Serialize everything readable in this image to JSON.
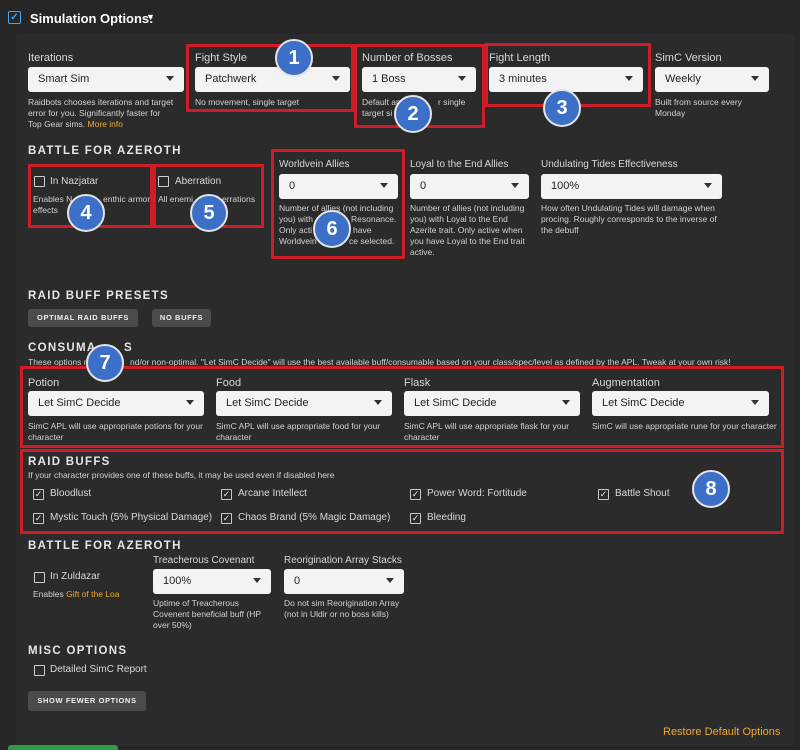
{
  "header": {
    "title": "Simulation Options:"
  },
  "iterations": {
    "label": "Iterations",
    "value": "Smart Sim",
    "help": "Raidbots chooses iterations and target error for you. Significantly faster for Top Gear sims.",
    "help_link": "More info"
  },
  "fight_style": {
    "label": "Fight Style",
    "value": "Patchwerk",
    "help": "No movement, single target"
  },
  "num_bosses": {
    "label": "Number of Bosses",
    "value": "1 Boss",
    "help_line1": "Default and",
    "help_line1b": "r single",
    "help_line2": "target si"
  },
  "fight_length": {
    "label": "Fight Length",
    "value": "3 minutes"
  },
  "simc_version": {
    "label": "SimC Version",
    "value": "Weekly",
    "help": "Built from source every Monday"
  },
  "bfa1": {
    "title": "BATTLE FOR AZEROTH",
    "nazjatar": {
      "label": "In Nazjatar",
      "help_a": "Enables N",
      "help_b": "enthic armor",
      "help_c": "effects"
    },
    "aberration": {
      "label": "Aberration",
      "help_a": "All enemi",
      "help_b": "errations"
    },
    "worldvein": {
      "label": "Worldvein Allies",
      "value": "0",
      "h1": "Number of allies (not including",
      "h2a": "you) with",
      "h2b": "Resonance.",
      "h3a": "Only acti",
      "h3b": "have",
      "h4a": "Worldvein",
      "h4b": "ce selected."
    },
    "loyal": {
      "label": "Loyal to the End Allies",
      "value": "0",
      "help": "Number of allies (not including you) with Loyal to the End Azerite trait. Only active when you have Loyal to the End trait active."
    },
    "tides": {
      "label": "Undulating Tides Effectiveness",
      "value": "100%",
      "help": "How often Undulating Tides will damage when procing. Roughly corresponds to the inverse of the debuff"
    }
  },
  "raid_presets": {
    "title": "RAID BUFF PRESETS",
    "optimal": "OPTIMAL RAID BUFFS",
    "none": "NO BUFFS"
  },
  "consumables": {
    "title_a": "CONSUMA",
    "title_b": "S",
    "note_a": "These options m",
    "note_b": "nd/or non-optimal. \"Let SimC Decide\" will use the best available buff/consumable based on your class/spec/level as defined by the APL. Tweak at your own risk!",
    "items": [
      {
        "label": "Potion",
        "value": "Let SimC Decide",
        "help": "SimC APL will use appropriate potions for your character"
      },
      {
        "label": "Food",
        "value": "Let SimC Decide",
        "help": "SimC APL will use appropriate food for your character"
      },
      {
        "label": "Flask",
        "value": "Let SimC Decide",
        "help": "SimC APL will use appropriate flask for your character"
      },
      {
        "label": "Augmentation",
        "value": "Let SimC Decide",
        "help": "SimC will use appropriate rune for your character"
      }
    ]
  },
  "raid_buffs": {
    "title": "RAID BUFFS",
    "note": "If your character provides one of these buffs, it may be used even if disabled here",
    "items": [
      "Bloodlust",
      "Arcane Intellect",
      "Power Word: Fortitude",
      "Battle Shout",
      "Mystic Touch (5% Physical Damage)",
      "Chaos Brand (5% Magic Damage)",
      "Bleeding"
    ]
  },
  "bfa2": {
    "title": "BATTLE FOR AZEROTH",
    "zuldazar": {
      "label": "In Zuldazar",
      "help": "Enables",
      "help_link": "Gift of the Loa"
    },
    "covenant": {
      "label": "Treacherous Covenant",
      "value": "100%",
      "help": "Uptime of Treacherous Covenent beneficial buff (HP over 50%)"
    },
    "reorig": {
      "label": "Reorigination Array Stacks",
      "value": "0",
      "help": "Do not sim Reorigination Array (not in Uldir or no boss kills)"
    }
  },
  "misc": {
    "title": "MISC OPTIONS",
    "detailed": "Detailed SimC Report",
    "fewer": "SHOW FEWER OPTIONS",
    "restore": "Restore Default Options"
  },
  "badges": [
    "1",
    "2",
    "3",
    "4",
    "5",
    "6",
    "7",
    "8"
  ]
}
